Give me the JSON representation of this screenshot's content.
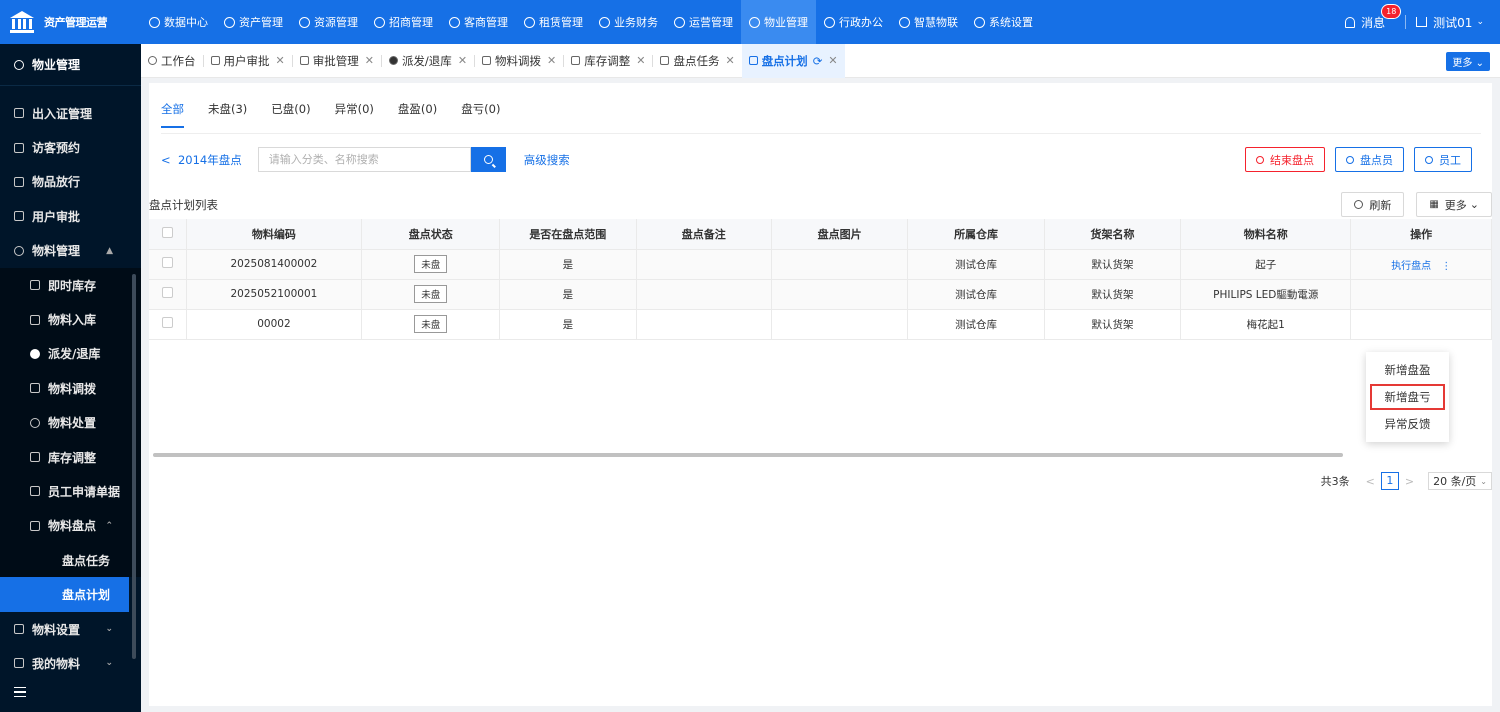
{
  "app": {
    "title": "资产管理运营"
  },
  "topnav": [
    {
      "label": "数据中心",
      "icon": "dashboard-icon"
    },
    {
      "label": "资产管理",
      "icon": "cube-icon"
    },
    {
      "label": "资源管理",
      "icon": "building-icon"
    },
    {
      "label": "招商管理",
      "icon": "tag-icon"
    },
    {
      "label": "客商管理",
      "icon": "users-icon"
    },
    {
      "label": "租赁管理",
      "icon": "home-icon"
    },
    {
      "label": "业务财务",
      "icon": "finance-icon"
    },
    {
      "label": "运营管理",
      "icon": "ops-icon"
    },
    {
      "label": "物业管理",
      "icon": "property-icon",
      "active": true
    },
    {
      "label": "行政办公",
      "icon": "office-icon"
    },
    {
      "label": "智慧物联",
      "icon": "iot-icon"
    },
    {
      "label": "系统设置",
      "icon": "settings-icon"
    }
  ],
  "header": {
    "messages_label": "消息",
    "messages_count": "18",
    "user_label": "测试01"
  },
  "sidebar": {
    "title": "物业管理",
    "items": [
      {
        "label": "出入证管理",
        "level": 0
      },
      {
        "label": "访客预约",
        "level": 0
      },
      {
        "label": "物品放行",
        "level": 0
      },
      {
        "label": "用户审批",
        "level": 0
      },
      {
        "label": "物料管理",
        "level": 0,
        "expanded": true
      },
      {
        "label": "即时库存",
        "level": 1
      },
      {
        "label": "物料入库",
        "level": 1
      },
      {
        "label": "派发/退库",
        "level": 1
      },
      {
        "label": "物料调拨",
        "level": 1
      },
      {
        "label": "物料处置",
        "level": 1
      },
      {
        "label": "库存调整",
        "level": 1
      },
      {
        "label": "员工申请单据",
        "level": 1
      },
      {
        "label": "物料盘点",
        "level": 1,
        "expanded": true
      },
      {
        "label": "盘点任务",
        "level": 2
      },
      {
        "label": "盘点计划",
        "level": 2,
        "active": true
      },
      {
        "label": "物料设置",
        "level": 0,
        "collapsed": true
      },
      {
        "label": "我的物料",
        "level": 0,
        "collapsed": true
      }
    ]
  },
  "tabs": [
    {
      "label": "工作台",
      "closable": false
    },
    {
      "label": "用户审批",
      "closable": true
    },
    {
      "label": "审批管理",
      "closable": true
    },
    {
      "label": "派发/退库",
      "closable": true
    },
    {
      "label": "物料调拨",
      "closable": true
    },
    {
      "label": "库存调整",
      "closable": true
    },
    {
      "label": "盘点任务",
      "closable": true
    },
    {
      "label": "盘点计划",
      "closable": true,
      "active": true
    }
  ],
  "tabs_more_label": "更多",
  "filter_tabs": [
    {
      "label": "全部",
      "active": true
    },
    {
      "label": "未盘(3)"
    },
    {
      "label": "已盘(0)"
    },
    {
      "label": "异常(0)"
    },
    {
      "label": "盘盈(0)"
    },
    {
      "label": "盘亏(0)"
    }
  ],
  "search": {
    "back_label": "2014年盘点",
    "placeholder": "请输入分类、名称搜索",
    "advanced_label": "高级搜索"
  },
  "actions": {
    "end_label": "结束盘点",
    "inspector_label": "盘点员",
    "employee_label": "员工"
  },
  "list": {
    "title": "盘点计划列表",
    "refresh_label": "刷新",
    "more_label": "更多",
    "columns": [
      "物料编码",
      "盘点状态",
      "是否在盘点范围",
      "盘点备注",
      "盘点图片",
      "所属仓库",
      "货架名称",
      "物料名称",
      "操作"
    ],
    "rows": [
      {
        "code": "2025081400002",
        "status": "未盘",
        "in_scope": "是",
        "remark": "",
        "image": "",
        "warehouse": "测试仓库",
        "shelf": "默认货架",
        "name": "起子",
        "op": "执行盘点"
      },
      {
        "code": "2025052100001",
        "status": "未盘",
        "in_scope": "是",
        "remark": "",
        "image": "",
        "warehouse": "测试仓库",
        "shelf": "默认货架",
        "name": "PHILIPS LED驅動電源",
        "op": ""
      },
      {
        "code": "00002",
        "status": "未盘",
        "in_scope": "是",
        "remark": "",
        "image": "",
        "warehouse": "测试仓库",
        "shelf": "默认货架",
        "name": "梅花起1",
        "op": ""
      }
    ]
  },
  "dropdown": [
    {
      "label": "新增盘盈"
    },
    {
      "label": "新增盘亏",
      "highlight": true
    },
    {
      "label": "异常反馈"
    }
  ],
  "pager": {
    "total": "共3条",
    "current": "1",
    "size": "20 条/页"
  },
  "colors": {
    "primary": "#1670e6",
    "sidebar_bg": "#001529",
    "danger": "#f5222d"
  }
}
